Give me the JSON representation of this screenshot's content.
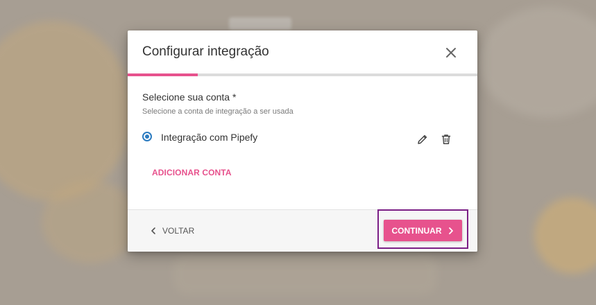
{
  "dialog": {
    "title": "Configurar integração",
    "progress_fraction": 0.2,
    "field": {
      "label": "Selecione sua conta *",
      "hint": "Selecione a conta de integração a ser usada"
    },
    "accounts": [
      {
        "name": "Integração com Pipefy",
        "selected": true
      }
    ],
    "add_account_label": "ADICIONAR CONTA",
    "footer": {
      "back_label": "VOLTAR",
      "continue_label": "CONTINUAR"
    }
  },
  "icons": {
    "close": "close-icon",
    "edit": "pencil-icon",
    "delete": "trash-icon",
    "back": "chevron-left-icon",
    "continue": "chevron-right-icon"
  },
  "colors": {
    "accent": "#e7528d",
    "radio": "#2b7bc0",
    "highlight": "#7b1f86"
  }
}
